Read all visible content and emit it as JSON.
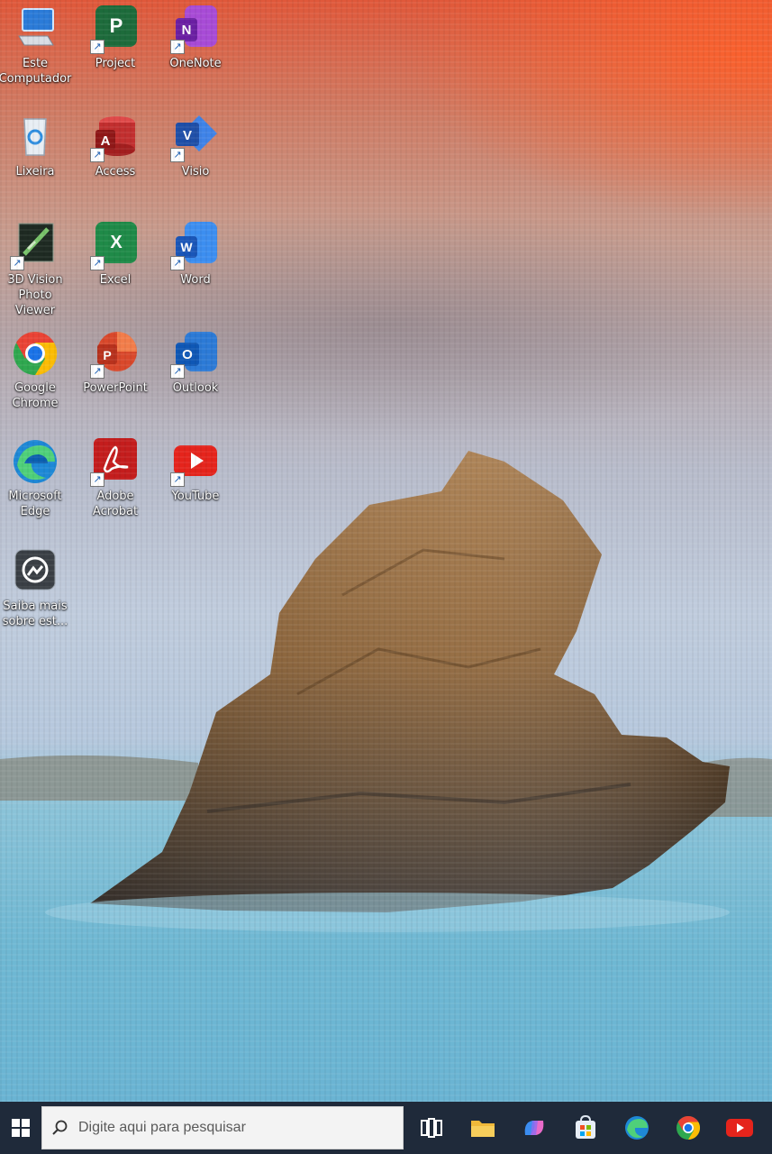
{
  "desktop": {
    "icons": [
      {
        "name": "computer",
        "label": "Este Computador"
      },
      {
        "name": "project",
        "label": "Project"
      },
      {
        "name": "onenote",
        "label": "OneNote"
      },
      {
        "name": "recycle-bin",
        "label": "Lixeira"
      },
      {
        "name": "access",
        "label": "Access"
      },
      {
        "name": "visio",
        "label": "Visio"
      },
      {
        "name": "3d-vision",
        "label": "3D Vision Photo Viewer"
      },
      {
        "name": "excel",
        "label": "Excel"
      },
      {
        "name": "word",
        "label": "Word"
      },
      {
        "name": "chrome",
        "label": "Google Chrome"
      },
      {
        "name": "powerpoint",
        "label": "PowerPoint"
      },
      {
        "name": "outlook",
        "label": "Outlook"
      },
      {
        "name": "edge",
        "label": "Microsoft Edge"
      },
      {
        "name": "acrobat",
        "label": "Adobe Acrobat"
      },
      {
        "name": "youtube",
        "label": "YouTube"
      },
      {
        "name": "learn-more",
        "label": "Saiba mais sobre est..."
      }
    ]
  },
  "taskbar": {
    "search_placeholder": "Digite aqui para pesquisar",
    "pinned": [
      "task-view-icon",
      "file-explorer-icon",
      "copilot-icon",
      "store-icon",
      "edge-icon",
      "chrome-icon",
      "youtube-icon"
    ]
  },
  "colors": {
    "taskbar": "#1f2a3a",
    "sky_top": "#e0583a",
    "sea": "#6ab4d3"
  }
}
